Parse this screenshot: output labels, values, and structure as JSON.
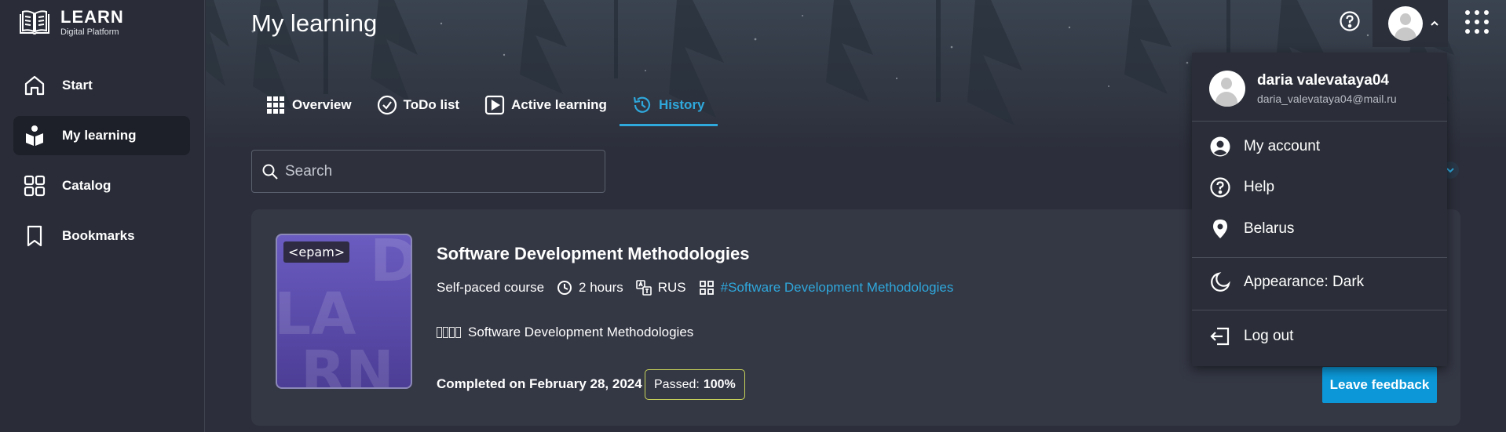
{
  "brand": {
    "title": "LEARN",
    "subtitle": "Digital Platform"
  },
  "sidebar": {
    "items": [
      {
        "label": "Start",
        "icon": "home-icon"
      },
      {
        "label": "My learning",
        "icon": "learning-icon",
        "active": true
      },
      {
        "label": "Catalog",
        "icon": "grid-icon"
      },
      {
        "label": "Bookmarks",
        "icon": "bookmark-icon"
      }
    ]
  },
  "header": {
    "title": "My learning"
  },
  "tabs": [
    {
      "label": "Overview",
      "icon": "grid-icon"
    },
    {
      "label": "ToDo list",
      "icon": "check-circle-icon"
    },
    {
      "label": "Active learning",
      "icon": "play-icon"
    },
    {
      "label": "History",
      "icon": "history-icon",
      "active": true
    }
  ],
  "search": {
    "placeholder": "Search"
  },
  "course": {
    "title": "Software Development Methodologies",
    "type": "Self-paced course",
    "duration": "2 hours",
    "language": "RUS",
    "tag": "#Software Development Methodologies",
    "skill": "Software Development Methodologies",
    "completed": "Completed on February 28, 2024",
    "passed_label": "Passed:",
    "passed_value": "100%",
    "feedback_label": "Leave feedback",
    "thumb_brand": "<epam>"
  },
  "user_menu": {
    "name": "daria valevataya04",
    "email": "daria_valevataya04@mail.ru",
    "items": [
      {
        "label": "My account",
        "icon": "account-icon"
      },
      {
        "label": "Help",
        "icon": "help-icon"
      },
      {
        "label": "Belarus",
        "icon": "location-icon"
      },
      {
        "label": "Appearance: Dark",
        "icon": "moon-icon"
      },
      {
        "label": "Log out",
        "icon": "logout-icon"
      }
    ]
  },
  "colors": {
    "accent": "#2fa8dc",
    "button": "#0c98d8",
    "passed_border": "#c9d55a",
    "background": "#2c2f3b"
  }
}
